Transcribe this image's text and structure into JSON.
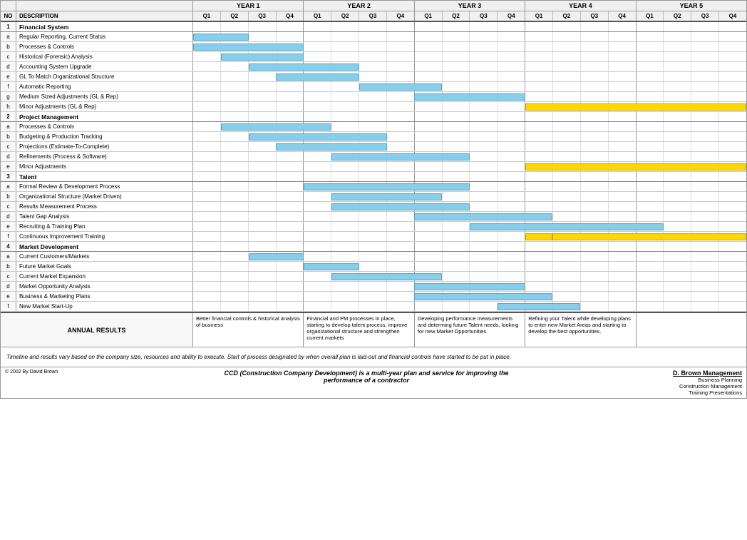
{
  "years": [
    "YEAR 1",
    "YEAR 2",
    "YEAR 3",
    "YEAR 4",
    "YEAR 5"
  ],
  "quarters": [
    "Q1",
    "Q2",
    "Q3",
    "Q4",
    "Q1",
    "Q2",
    "Q3",
    "Q4",
    "Q1",
    "Q2",
    "Q3",
    "Q4",
    "Q1",
    "Q2",
    "Q3",
    "Q4",
    "Q1",
    "Q2",
    "Q3",
    "Q4"
  ],
  "columns": {
    "no": "NO",
    "description": "DESCRIPTION"
  },
  "sections": [
    {
      "no": "1",
      "title": "Financial System",
      "rows": [
        {
          "letter": "a",
          "desc": "Regular Reporting, Current Status",
          "bars": [
            {
              "start": 0,
              "end": 2,
              "type": "blue"
            }
          ]
        },
        {
          "letter": "b",
          "desc": "Processes & Controls",
          "bars": [
            {
              "start": 0,
              "end": 4,
              "type": "blue"
            }
          ]
        },
        {
          "letter": "c",
          "desc": "Historical (Forensic) Analysis",
          "bars": [
            {
              "start": 1,
              "end": 4,
              "type": "blue"
            }
          ]
        },
        {
          "letter": "d",
          "desc": "Accounting System Upgrade",
          "bars": [
            {
              "start": 2,
              "end": 6,
              "type": "blue"
            }
          ]
        },
        {
          "letter": "e",
          "desc": "GL To Match Organizational Structure",
          "bars": [
            {
              "start": 3,
              "end": 6,
              "type": "blue"
            }
          ]
        },
        {
          "letter": "f",
          "desc": "Automatic Reporting",
          "bars": [
            {
              "start": 6,
              "end": 9,
              "type": "blue"
            }
          ]
        },
        {
          "letter": "g",
          "desc": "Medium Sized Adjustments (GL & Rep)",
          "bars": [
            {
              "start": 8,
              "end": 12,
              "type": "blue"
            }
          ]
        },
        {
          "letter": "h",
          "desc": "Minor Adjustments (GL & Rep)",
          "bars": [
            {
              "start": 12,
              "end": 20,
              "type": "yellow"
            }
          ]
        }
      ]
    },
    {
      "no": "2",
      "title": "Project Management",
      "rows": [
        {
          "letter": "a",
          "desc": "Processes & Controls",
          "bars": [
            {
              "start": 1,
              "end": 5,
              "type": "blue"
            }
          ]
        },
        {
          "letter": "b",
          "desc": "Budgeting & Production Tracking",
          "bars": [
            {
              "start": 2,
              "end": 7,
              "type": "blue"
            }
          ]
        },
        {
          "letter": "c",
          "desc": "Projections (Estimate-To-Complete)",
          "bars": [
            {
              "start": 3,
              "end": 7,
              "type": "blue"
            }
          ]
        },
        {
          "letter": "d",
          "desc": "Refinements (Process & Software)",
          "bars": [
            {
              "start": 5,
              "end": 10,
              "type": "blue"
            }
          ]
        },
        {
          "letter": "e",
          "desc": "Minor Adjustments",
          "bars": [
            {
              "start": 12,
              "end": 20,
              "type": "yellow"
            }
          ]
        }
      ]
    },
    {
      "no": "3",
      "title": "Talent",
      "rows": [
        {
          "letter": "a",
          "desc": "Formal Review & Development Process",
          "bars": [
            {
              "start": 4,
              "end": 10,
              "type": "blue"
            }
          ]
        },
        {
          "letter": "b",
          "desc": "Organizational Structure (Market Driven)",
          "bars": [
            {
              "start": 5,
              "end": 9,
              "type": "blue"
            }
          ]
        },
        {
          "letter": "c",
          "desc": "Results Measurement Process",
          "bars": [
            {
              "start": 5,
              "end": 10,
              "type": "blue"
            }
          ]
        },
        {
          "letter": "d",
          "desc": "Talent Gap Analysis",
          "bars": [
            {
              "start": 8,
              "end": 13,
              "type": "blue"
            }
          ]
        },
        {
          "letter": "e",
          "desc": "Recruiting & Training Plan",
          "bars": [
            {
              "start": 10,
              "end": 17,
              "type": "blue"
            }
          ]
        },
        {
          "letter": "f",
          "desc": "Continuous Improvement Training",
          "bars": [
            {
              "start": 12,
              "end": 13,
              "type": "yellow"
            },
            {
              "start": 13,
              "end": 20,
              "type": "yellow"
            }
          ]
        }
      ]
    },
    {
      "no": "4",
      "title": "Market Development",
      "rows": [
        {
          "letter": "a",
          "desc": "Current Customers/Markets",
          "bars": [
            {
              "start": 2,
              "end": 4,
              "type": "blue"
            }
          ]
        },
        {
          "letter": "b",
          "desc": "Future Market Goals",
          "bars": [
            {
              "start": 4,
              "end": 6,
              "type": "blue"
            }
          ]
        },
        {
          "letter": "c",
          "desc": "Current Market Expansion",
          "bars": [
            {
              "start": 5,
              "end": 9,
              "type": "blue"
            }
          ]
        },
        {
          "letter": "d",
          "desc": "Market Opportunity Analysis",
          "bars": [
            {
              "start": 8,
              "end": 12,
              "type": "blue"
            }
          ]
        },
        {
          "letter": "e",
          "desc": "Business & Marketing Plans",
          "bars": [
            {
              "start": 8,
              "end": 13,
              "type": "blue"
            }
          ]
        },
        {
          "letter": "f",
          "desc": "New Market Start-Up",
          "bars": [
            {
              "start": 11,
              "end": 14,
              "type": "blue"
            }
          ]
        }
      ]
    }
  ],
  "annual_results": {
    "label": "ANNUAL RESULTS",
    "year1": "Better financial controls & historical analysis of business",
    "year2": "Financial and PM processes in place, starting to develop talent process, improve organizational structure and strengthen current markets",
    "year3": "Developing performance measurements and determing future Talent needs, looking for new Market Opportunities.",
    "year4": "Refining your Talent while developing plans to enter new Market Areas and starting to develop the best opportunities.",
    "year5": ""
  },
  "note": "Timeline and results vary based on the company size, resources and ability to execute.  Start of process designated by when overall plan is laid-out and financial controls have started to be put in place.",
  "footer": {
    "copyright": "© 2002 By David Brown",
    "center_line1": "CCD (Construction Company Development) is a multi-year plan and service for improving the",
    "center_line2": "performance of a contractor",
    "company": "D. Brown Management",
    "sub1": "Business Planning",
    "sub2": "Construction Management",
    "sub3": "Training Presentations"
  }
}
